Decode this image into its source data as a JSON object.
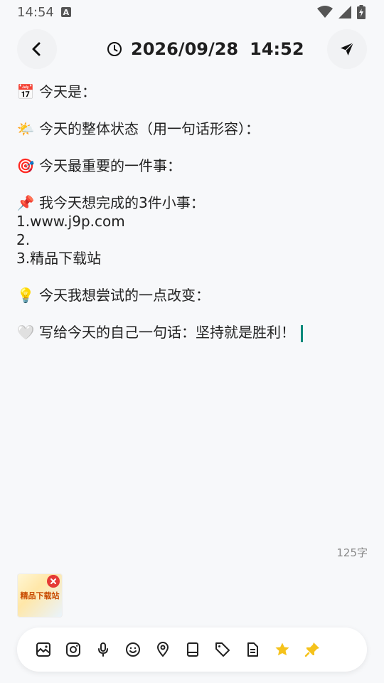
{
  "status_bar": {
    "time": "14:54",
    "notification_badge": "A",
    "icons": [
      "wifi-icon",
      "signal-icon",
      "battery-charging-icon"
    ]
  },
  "header": {
    "date": "2026/09/28",
    "time": "14:52",
    "back_icon": "chevron-left-icon",
    "clock_icon": "clock-icon",
    "send_icon": "send-icon"
  },
  "journal": {
    "lines": [
      {
        "emoji": "📅",
        "text": "今天是："
      },
      {
        "emoji": "🌤️",
        "text": "今天的整体状态（用一句话形容）："
      },
      {
        "emoji": "🎯",
        "text": "今天最重要的一件事："
      },
      {
        "emoji": "📌",
        "text": "我今天想完成的3件小事："
      },
      {
        "text": "1.www.j9p.com"
      },
      {
        "text": "2."
      },
      {
        "text": "3.精品下载站"
      },
      {
        "emoji": "💡",
        "text": "今天我想尝试的一点改变："
      },
      {
        "emoji": "🤍",
        "text": "写给今天的自己一句话：坚持就是胜利！"
      }
    ]
  },
  "word_count": "125字",
  "attachment": {
    "logo_text": "精品下载站"
  },
  "toolbar": {
    "icons": [
      "image-icon",
      "instagram-icon",
      "microphone-icon",
      "emoji-icon",
      "location-icon",
      "book-icon",
      "tag-icon",
      "document-icon",
      "star-icon",
      "pin-icon"
    ],
    "accent_color": "#f5c21b"
  },
  "colors": {
    "background": "#f7f8fa",
    "cursor": "#00897b",
    "remove": "#e53935"
  }
}
